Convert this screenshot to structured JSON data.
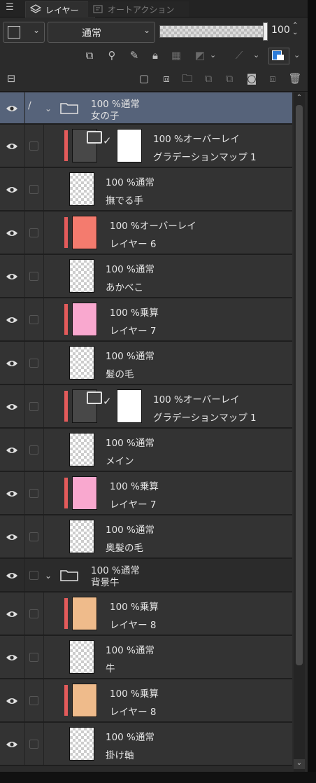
{
  "tabs": [
    {
      "label": "レイヤー",
      "active": true
    },
    {
      "label": "オートアクション",
      "active": false
    }
  ],
  "toolbar": {
    "blend_mode": "通常",
    "opacity": "100",
    "color_accent": "#2c7bd8"
  },
  "layers": [
    {
      "type": "folder",
      "line1": "100 %通常",
      "line2": "女の子",
      "selected": true,
      "editing": true
    },
    {
      "type": "gradient",
      "line1": "100 %オーバーレイ",
      "line2": "グラデーションマップ 1",
      "clip": true
    },
    {
      "type": "raster",
      "line1": "100 %通常",
      "line2": "撫でる手",
      "thumb": "checker"
    },
    {
      "type": "fill",
      "line1": "100 %オーバーレイ",
      "line2": "レイヤー 6",
      "clip": true,
      "color": "#f47b6e"
    },
    {
      "type": "raster",
      "line1": "100 %通常",
      "line2": "あかべこ",
      "thumb": "checker"
    },
    {
      "type": "fill",
      "line1": "100 %乗算",
      "line2": "レイヤー 7",
      "clip": true,
      "color": "#f9a8cf"
    },
    {
      "type": "raster",
      "line1": "100 %通常",
      "line2": "髪の毛",
      "thumb": "checker"
    },
    {
      "type": "gradient",
      "line1": "100 %オーバーレイ",
      "line2": "グラデーションマップ 1",
      "clip": true
    },
    {
      "type": "raster",
      "line1": "100 %通常",
      "line2": "メイン",
      "thumb": "checker"
    },
    {
      "type": "fill",
      "line1": "100 %乗算",
      "line2": "レイヤー 7",
      "clip": true,
      "color": "#f9a8cf"
    },
    {
      "type": "raster",
      "line1": "100 %通常",
      "line2": "奥髪の毛",
      "thumb": "checker"
    },
    {
      "type": "folder",
      "line1": "100 %通常",
      "line2": "背景牛",
      "selected": false,
      "editing": false
    },
    {
      "type": "fill",
      "line1": "100 %乗算",
      "line2": "レイヤー 8",
      "clip": true,
      "color": "#efbb8b"
    },
    {
      "type": "raster",
      "line1": "100 %通常",
      "line2": "牛",
      "thumb": "checker"
    },
    {
      "type": "fill",
      "line1": "100 %乗算",
      "line2": "レイヤー 8",
      "clip": true,
      "color": "#efbb8b"
    },
    {
      "type": "raster",
      "line1": "100 %通常",
      "line2": "掛け軸",
      "thumb": "checker"
    }
  ]
}
